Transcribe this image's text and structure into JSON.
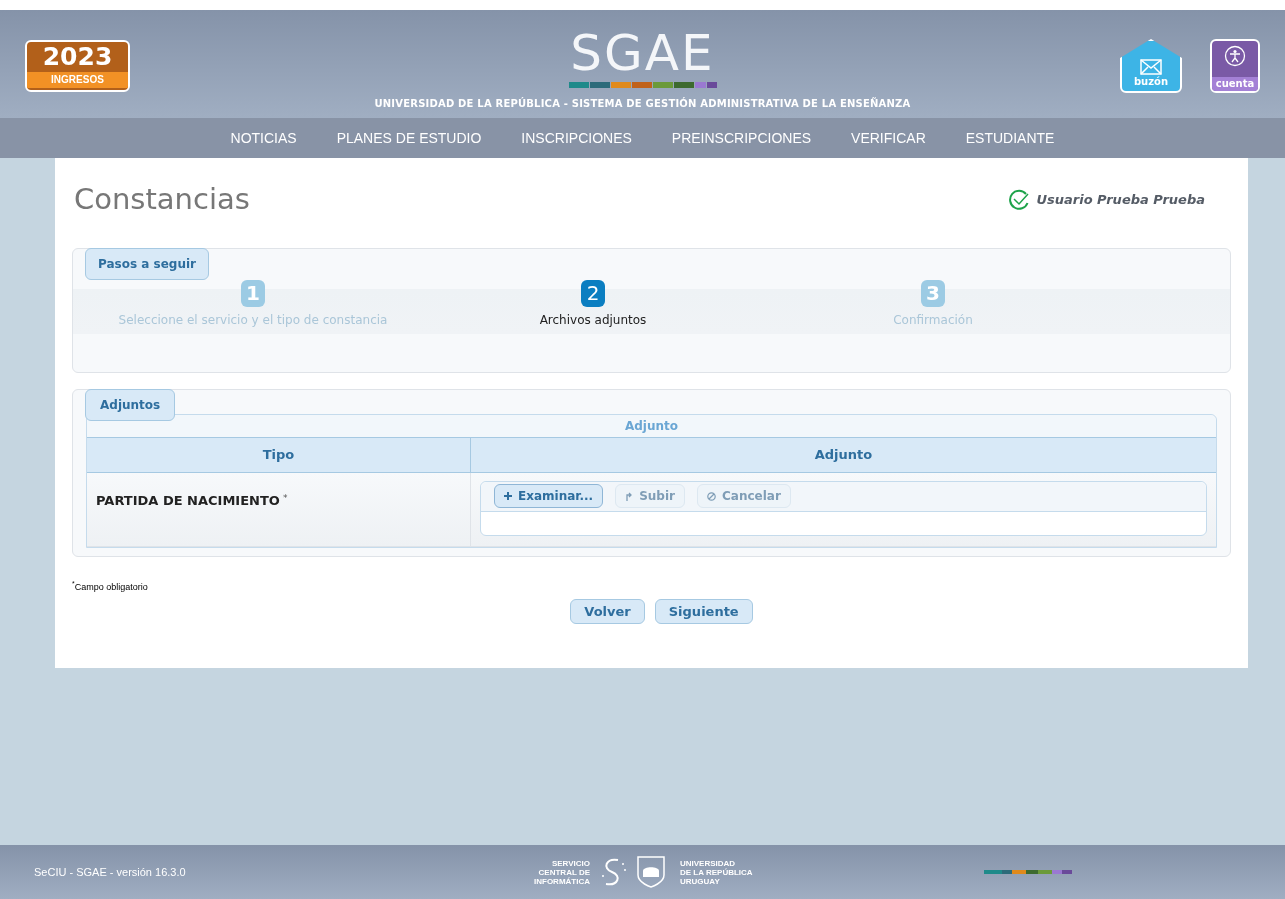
{
  "header": {
    "badge": {
      "year": "2023",
      "label": "INGRESOS"
    },
    "logo": "SGAE",
    "subtitle": "UNIVERSIDAD DE LA REPÚBLICA - SISTEMA DE GESTIÓN ADMINISTRATIVA DE LA ENSEÑANZA",
    "actions": [
      {
        "kind": "mail",
        "label": "buzón"
      },
      {
        "kind": "account",
        "label": "cuenta"
      }
    ]
  },
  "nav": {
    "items": [
      "NOTICIAS",
      "PLANES DE ESTUDIO",
      "INSCRIPCIONES",
      "PREINSCRIPCIONES",
      "VERIFICAR",
      "ESTUDIANTE"
    ]
  },
  "page": {
    "title": "Constancias",
    "user": "Usuario Prueba Prueba"
  },
  "steps": {
    "legend": "Pasos a seguir",
    "items": [
      {
        "number": "1",
        "label": "Seleccione el servicio y el tipo de constancia",
        "selected": false
      },
      {
        "number": "2",
        "label": "Archivos adjuntos",
        "selected": true
      },
      {
        "number": "3",
        "label": "Confirmación",
        "selected": false
      }
    ]
  },
  "attachments": {
    "legend": "Adjuntos",
    "caption": "Adjunto",
    "columns": [
      "Tipo",
      "Adjunto"
    ],
    "rows": [
      {
        "tipo": "PARTIDA DE NACIMIENTO",
        "required_mark": "*",
        "buttons": [
          {
            "kind": "plus",
            "label": "Examinar...",
            "disabled": false
          },
          {
            "kind": "upload",
            "label": "Subir",
            "disabled": true
          },
          {
            "kind": "cancel",
            "label": "Cancelar",
            "disabled": true
          }
        ]
      }
    ]
  },
  "footnote": "$^{*}$Campo obligatorio",
  "buttons": [
    "Volver",
    "Siguiente"
  ],
  "footer": {
    "version": "SeCIU - SGAE - versión 16.3.0",
    "logo_left": [
      "SERVICIO",
      "CENTRAL DE",
      "INFORMÁTICA"
    ],
    "logo_right": [
      "UNIVERSIDAD",
      "DE LA REPÚBLICA",
      "URUGUAY"
    ]
  }
}
